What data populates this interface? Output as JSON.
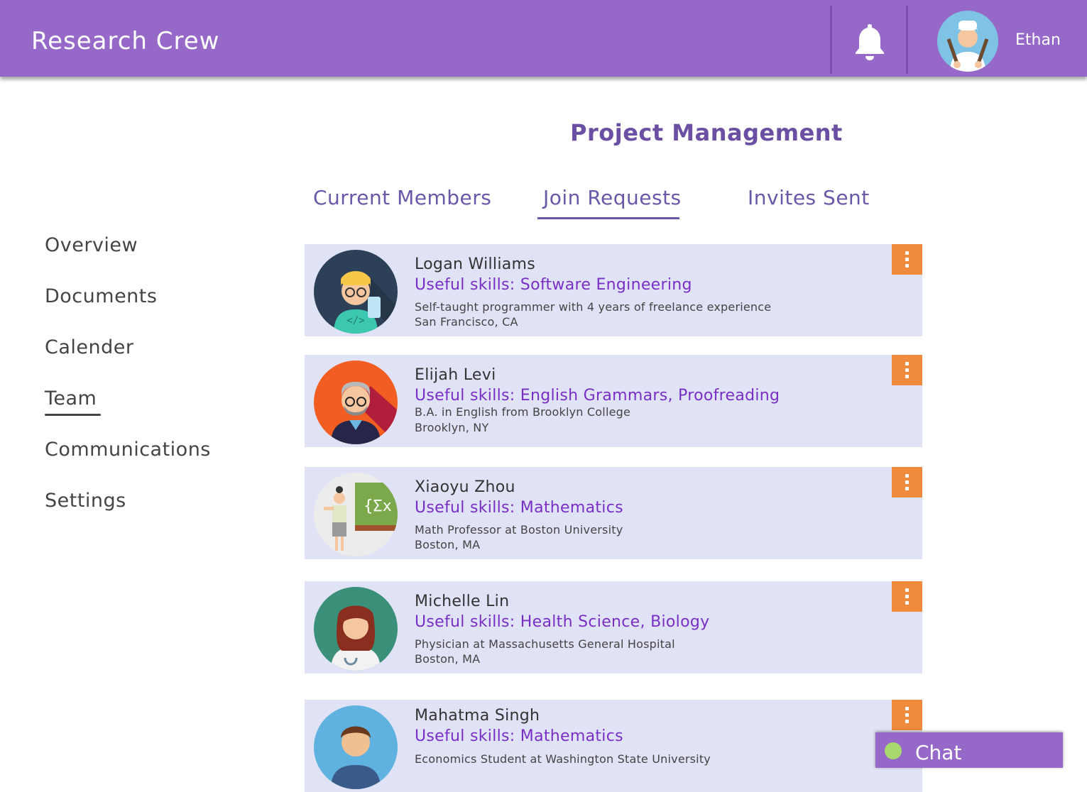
{
  "header": {
    "app_title": "Research Crew",
    "user_name": "Ethan"
  },
  "page_title": "Project Management",
  "tabs": [
    {
      "label": "Current Members"
    },
    {
      "label": "Join Requests",
      "active": true
    },
    {
      "label": "Invites Sent"
    }
  ],
  "sidebar": {
    "items": [
      {
        "label": "Overview"
      },
      {
        "label": "Documents"
      },
      {
        "label": "Calender"
      },
      {
        "label": "Team",
        "active": true
      },
      {
        "label": "Communications"
      },
      {
        "label": "Settings"
      }
    ]
  },
  "requests": [
    {
      "name": "Logan Williams",
      "skills": "Useful skills: Software Engineering",
      "desc": "Self-taught programmer with 4 years of freelance experience",
      "location": "San Francisco, CA"
    },
    {
      "name": "Elijah Levi",
      "skills": "Useful skills: English Grammars, Proofreading",
      "desc": "B.A. in English from Brooklyn College",
      "location": "Brooklyn, NY"
    },
    {
      "name": "Xiaoyu Zhou",
      "skills": "Useful skills: Mathematics",
      "desc": "Math Professor at Boston University",
      "location": "Boston, MA"
    },
    {
      "name": "Michelle Lin",
      "skills": "Useful skills: Health Science, Biology",
      "desc": "Physician at Massachusetts General Hospital",
      "location": "Boston, MA"
    },
    {
      "name": "Mahatma Singh",
      "skills": "Useful skills: Mathematics",
      "desc": "Economics Student at Washington State University",
      "location": ""
    }
  ],
  "chat": {
    "label": "Chat"
  },
  "colors": {
    "header_bg": "#9669c8",
    "card_bg": "#e0e2f5",
    "menu_accent": "#f08a3c",
    "skills_text": "#7a2fc4",
    "tab_text": "#6a57a8",
    "online_dot": "#a9d86e"
  },
  "icons": {
    "notifications": "bell-icon",
    "card_menu": "more-vertical-icon"
  }
}
